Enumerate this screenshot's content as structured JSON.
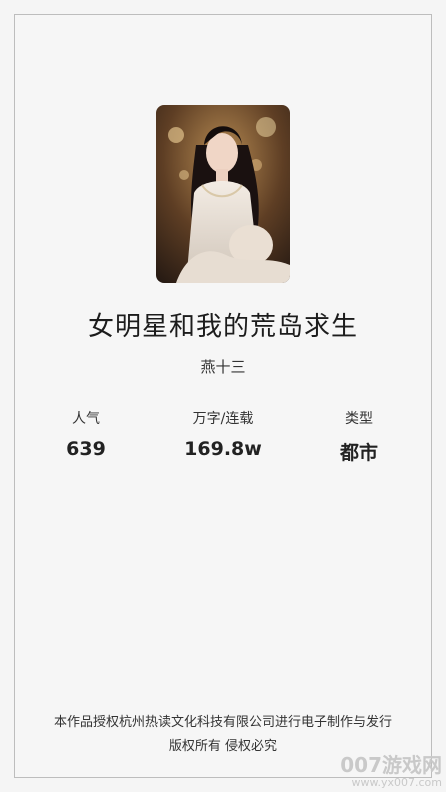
{
  "book": {
    "title": "女明星和我的荒岛求生",
    "author": "燕十三",
    "cover_alt": "book-cover"
  },
  "stats": [
    {
      "label": "人气",
      "value": "639"
    },
    {
      "label": "万字/连载",
      "value": "169.8w"
    },
    {
      "label": "类型",
      "value": "都市"
    }
  ],
  "footer": {
    "line1": "本作品授权杭州热读文化科技有限公司进行电子制作与发行",
    "line2": "版权所有 侵权必究"
  },
  "watermark": {
    "brand": "007游戏网",
    "url": "www.yx007.com"
  },
  "colors": {
    "background": "#f5f5f5",
    "border": "#bdbdbd"
  }
}
